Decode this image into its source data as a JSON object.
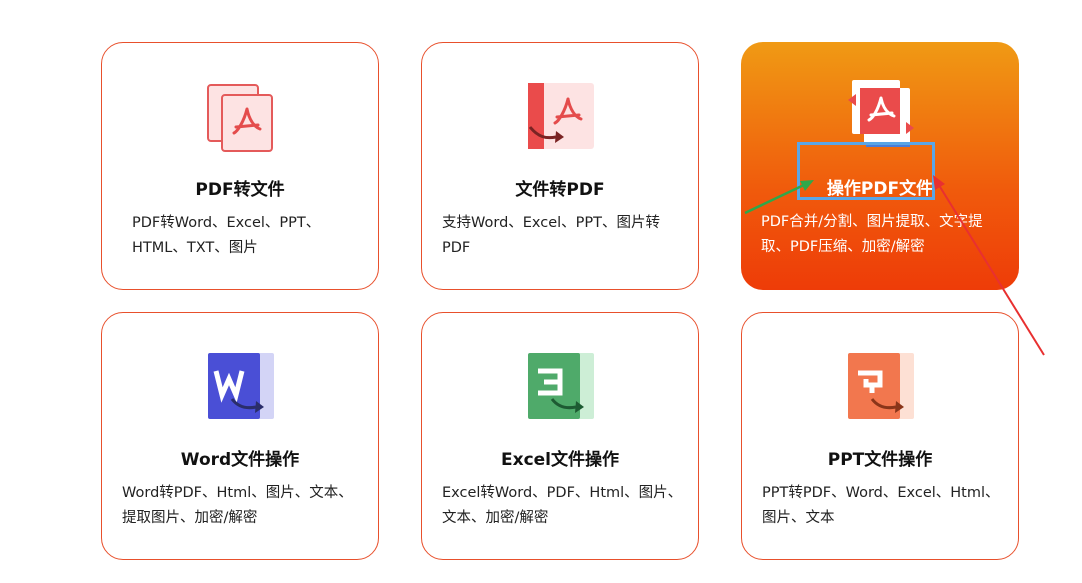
{
  "cards": [
    {
      "title": "PDF转文件",
      "desc": "PDF转Word、Excel、PPT、\nHTML、TXT、图片",
      "icon": "pdf-convert-icon"
    },
    {
      "title": "文件转PDF",
      "desc": "支持Word、Excel、PPT、图片转\nPDF",
      "icon": "file-to-pdf-icon"
    },
    {
      "title": "操作PDF文件",
      "desc": "PDF合并/分割、图片提取、文字提\n取、PDF压缩、加密/解密",
      "icon": "pdf-operate-icon"
    },
    {
      "title": "Word文件操作",
      "desc": "Word转PDF、Html、图片、文本、\n提取图片、加密/解密",
      "icon": "word-icon"
    },
    {
      "title": "Excel文件操作",
      "desc": "Excel转Word、PDF、Html、图片、\n文本、加密/解密",
      "icon": "excel-icon"
    },
    {
      "title": "PPT文件操作",
      "desc": "PPT转PDF、Word、Excel、Html、\n图片、文本",
      "icon": "ppt-icon"
    }
  ],
  "colors": {
    "border": "#e8502c",
    "active_top": "#f09a14",
    "active_bottom": "#ee3c08",
    "pdf_red": "#ea4b4b",
    "word_blue": "#4a4fd6",
    "excel_green": "#4faa6a",
    "ppt_orange": "#f2774e",
    "annotation_blue": "#5aa6e6",
    "annotation_green": "#2fa84a",
    "annotation_red": "#e83030"
  },
  "active_card_index": 2
}
